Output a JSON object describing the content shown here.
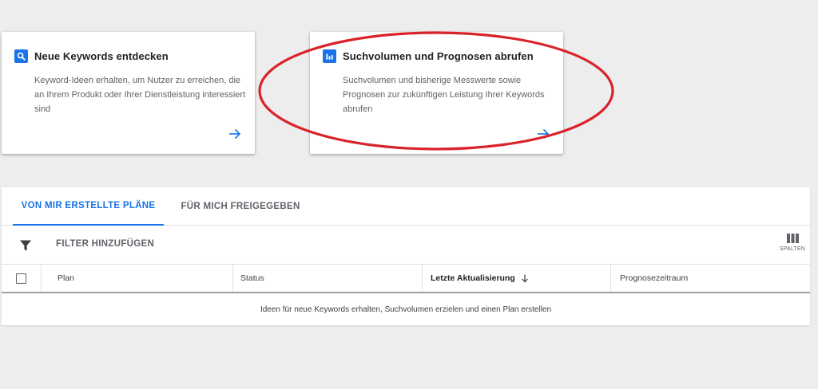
{
  "cards": [
    {
      "icon": "search-icon",
      "title": "Neue Keywords entdecken",
      "description": "Keyword-Ideen erhalten, um Nutzer zu erreichen, die an Ihrem Produkt oder Ihrer Dienstleistung interessiert sind"
    },
    {
      "icon": "bar-chart-icon",
      "title": "Suchvolumen und Prognosen abrufen",
      "description": "Suchvolumen und bisherige Messwerte sowie Prognosen zur zukünftigen Leistung Ihrer Keywords abrufen"
    }
  ],
  "tabs": [
    {
      "label": "VON MIR ERSTELLTE PLÄNE",
      "active": true
    },
    {
      "label": "FÜR MICH FREIGEGEBEN",
      "active": false
    }
  ],
  "filter": {
    "label": "FILTER HINZUFÜGEN"
  },
  "columns_button": {
    "label": "SPALTEN"
  },
  "table": {
    "headers": [
      "Plan",
      "Status",
      "Letzte Aktualisierung",
      "Prognosezeitraum"
    ],
    "sorted_column": "Letzte Aktualisierung",
    "sort_direction": "descending",
    "empty_message": "Ideen für neue Keywords erhalten, Suchvolumen erzielen und einen Plan erstellen"
  },
  "colors": {
    "accent": "#1a73e8",
    "highlight_ellipse": "#d9232a",
    "background": "#ededee"
  }
}
